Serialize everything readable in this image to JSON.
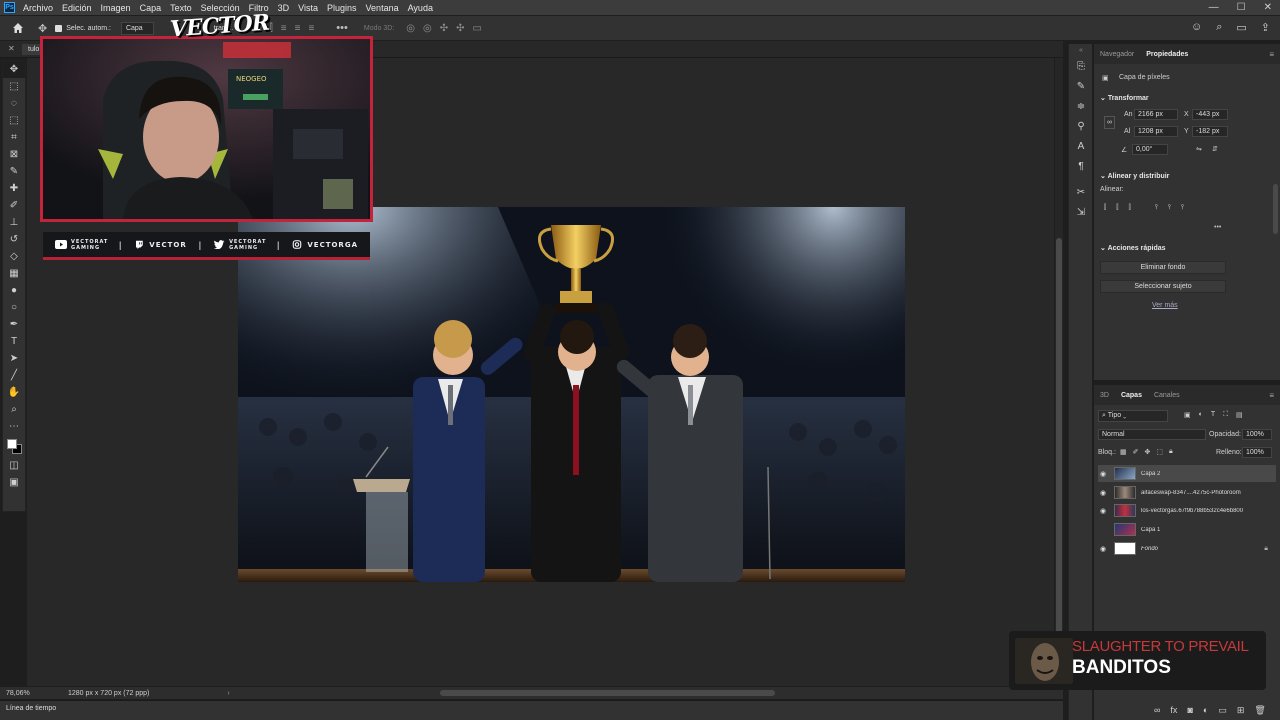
{
  "menubar": {
    "logo": "Ps",
    "items": [
      "Archivo",
      "Edición",
      "Imagen",
      "Capa",
      "Texto",
      "Selección",
      "Filtro",
      "3D",
      "Vista",
      "Plugins",
      "Ventana",
      "Ayuda"
    ]
  },
  "options": {
    "auto_select_label": "Selec. autom.:",
    "layer_select": "Capa",
    "transform_label": "transf.",
    "mode_3d": "Modo 3D:"
  },
  "doc_tab": {
    "title": "tulo"
  },
  "overlay": {
    "logo_text": "VECTOR",
    "social": [
      {
        "icon": "youtube-icon",
        "label": "VECTORAT GAMING"
      },
      {
        "icon": "twitch-icon",
        "label": "VECTOR"
      },
      {
        "icon": "twitter-icon",
        "label": "VECTORAT GAMING"
      },
      {
        "icon": "instagram-icon",
        "label": "VECTORGA"
      }
    ]
  },
  "status": {
    "zoom": "78,06%",
    "doc_info": "1280 px x 720 px (72 ppp)",
    "timeline": "Línea de tiempo"
  },
  "properties": {
    "tabs": [
      "Navegador",
      "Propiedades"
    ],
    "layer_type": "Capa de píxeles",
    "transform_title": "Transformar",
    "w_label": "An",
    "w_value": "2166 px",
    "h_label": "Al",
    "h_value": "1208 px",
    "x_label": "X",
    "x_value": "-443 px",
    "y_label": "Y",
    "y_value": "-182 px",
    "angle": "0,00°",
    "align_title": "Alinear y distribuir",
    "align_label": "Alinear:",
    "quick_title": "Acciones rápidas",
    "btn_remove_bg": "Eliminar fondo",
    "btn_select_subject": "Seleccionar sujeto",
    "see_more": "Ver más"
  },
  "layers": {
    "tabs": [
      "3D",
      "Capas",
      "Canales"
    ],
    "filter": "Tipo",
    "blend": "Normal",
    "opacity_label": "Opacidad:",
    "opacity": "100%",
    "lock_label": "Bloq.:",
    "fill_label": "Relleno:",
    "fill": "100%",
    "items": [
      {
        "name": "Capa 2",
        "visible": true,
        "selected": true
      },
      {
        "name": "aifaceswap-8347....4275c-Photoroom",
        "visible": true,
        "selected": false
      },
      {
        "name": "los-vectorgas.67f9b788b532c4e6b800",
        "visible": true,
        "selected": false
      },
      {
        "name": "Capa 1",
        "visible": false,
        "selected": false
      },
      {
        "name": "Fondo",
        "visible": true,
        "selected": false
      }
    ]
  },
  "now_playing": {
    "title": "SLAUGHTER TO PREVAIL",
    "artist": "BANDITOS"
  }
}
